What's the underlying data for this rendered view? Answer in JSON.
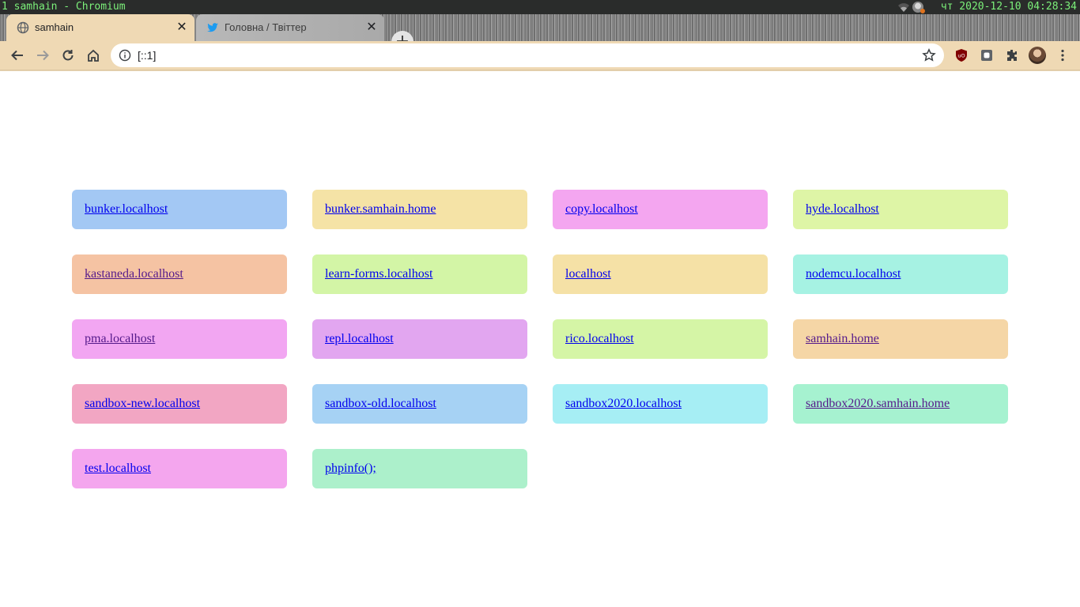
{
  "system_bar": {
    "left_text": "1 samhain - Chromium",
    "right_text": "чт 2020-12-10 04:28:34",
    "icons": [
      "wifi-icon",
      "user-status-icon"
    ]
  },
  "tabs": [
    {
      "label": "samhain",
      "icon": "globe-icon",
      "active": true
    },
    {
      "label": "Головна / Твіттер",
      "icon": "twitter-icon",
      "active": false
    }
  ],
  "new_tab_label": "+",
  "toolbar": {
    "url": "[::1]",
    "buttons": [
      "back-icon",
      "forward-icon",
      "reload-icon",
      "home-icon"
    ],
    "extensions": [
      "ublock-icon",
      "extension-box-icon",
      "puzzle-icon",
      "profile-avatar",
      "menu-icon"
    ]
  },
  "links": [
    {
      "label": "bunker.localhost",
      "bg": "#a3c8f4",
      "visited": false
    },
    {
      "label": "bunker.samhain.home",
      "bg": "#f5e3a6",
      "visited": false
    },
    {
      "label": "copy.localhost",
      "bg": "#f4a6f0",
      "visited": false
    },
    {
      "label": "hyde.localhost",
      "bg": "#def5a6",
      "visited": false
    },
    {
      "label": "kastaneda.localhost",
      "bg": "#f5c3a3",
      "visited": true
    },
    {
      "label": "learn-forms.localhost",
      "bg": "#d3f5a6",
      "visited": false
    },
    {
      "label": "localhost",
      "bg": "#f5e1a6",
      "visited": false
    },
    {
      "label": "nodemcu.localhost",
      "bg": "#a6f2e3",
      "visited": false
    },
    {
      "label": "pma.localhost",
      "bg": "#f2a6f2",
      "visited": true
    },
    {
      "label": "repl.localhost",
      "bg": "#e2a6f0",
      "visited": false
    },
    {
      "label": "rico.localhost",
      "bg": "#d5f5a6",
      "visited": false
    },
    {
      "label": "samhain.home",
      "bg": "#f5d6a6",
      "visited": true
    },
    {
      "label": "sandbox-new.localhost",
      "bg": "#f2a6c3",
      "visited": false
    },
    {
      "label": "sandbox-old.localhost",
      "bg": "#a6d2f4",
      "visited": false
    },
    {
      "label": "sandbox2020.localhost",
      "bg": "#a6eef4",
      "visited": false
    },
    {
      "label": "sandbox2020.samhain.home",
      "bg": "#a6f2d0",
      "visited": true
    },
    {
      "label": "test.localhost",
      "bg": "#f4a6ee",
      "visited": false
    },
    {
      "label": "phpinfo();",
      "bg": "#acf0cb",
      "visited": false
    }
  ]
}
